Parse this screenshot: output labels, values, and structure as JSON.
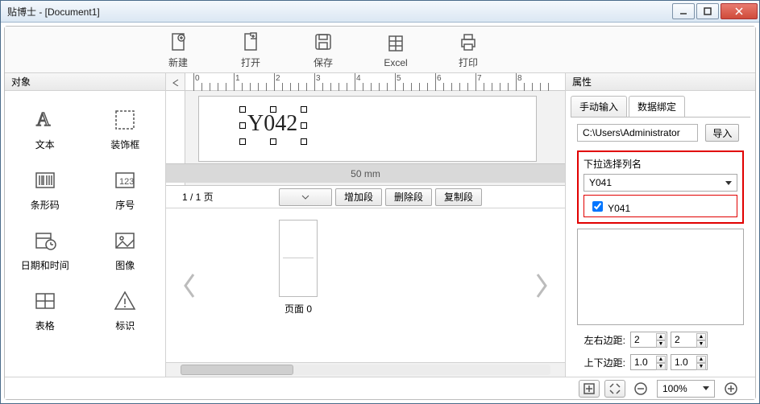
{
  "title_bar": "贴博士 - [Document1]",
  "toolbar": {
    "new": "新建",
    "open": "打开",
    "save": "保存",
    "excel": "Excel",
    "print": "打印"
  },
  "sidebar": {
    "header": "对象",
    "items": [
      {
        "label": "文本"
      },
      {
        "label": "装饰框"
      },
      {
        "label": "条形码"
      },
      {
        "label": "序号"
      },
      {
        "label": "日期和时间"
      },
      {
        "label": "图像"
      },
      {
        "label": "表格"
      },
      {
        "label": "标识"
      }
    ]
  },
  "canvas": {
    "sample_text": "Y042",
    "dim_label": "50 mm",
    "ruler_numbers": [
      "0",
      "1",
      "2",
      "3",
      "4",
      "5",
      "6",
      "7",
      "8"
    ]
  },
  "segbar": {
    "page_info": "1 / 1 页",
    "add": "增加段",
    "del": "删除段",
    "copy": "复制段"
  },
  "pagenav": {
    "thumb_label": "页面 0"
  },
  "props": {
    "header": "属性",
    "tabs": {
      "manual": "手动输入",
      "bind": "数据绑定"
    },
    "path": "C:\\Users\\Administrator",
    "import_btn": "导入",
    "dropdown_label": "下拉选择列名",
    "dropdown_value": "Y041",
    "check_item": "Y041",
    "lr_label": "左右边距:",
    "lr_values": [
      "2",
      "2"
    ],
    "tb_label": "上下边距:",
    "tb_values": [
      "1.0",
      "1.0"
    ]
  },
  "zoom": {
    "value": "100%"
  }
}
